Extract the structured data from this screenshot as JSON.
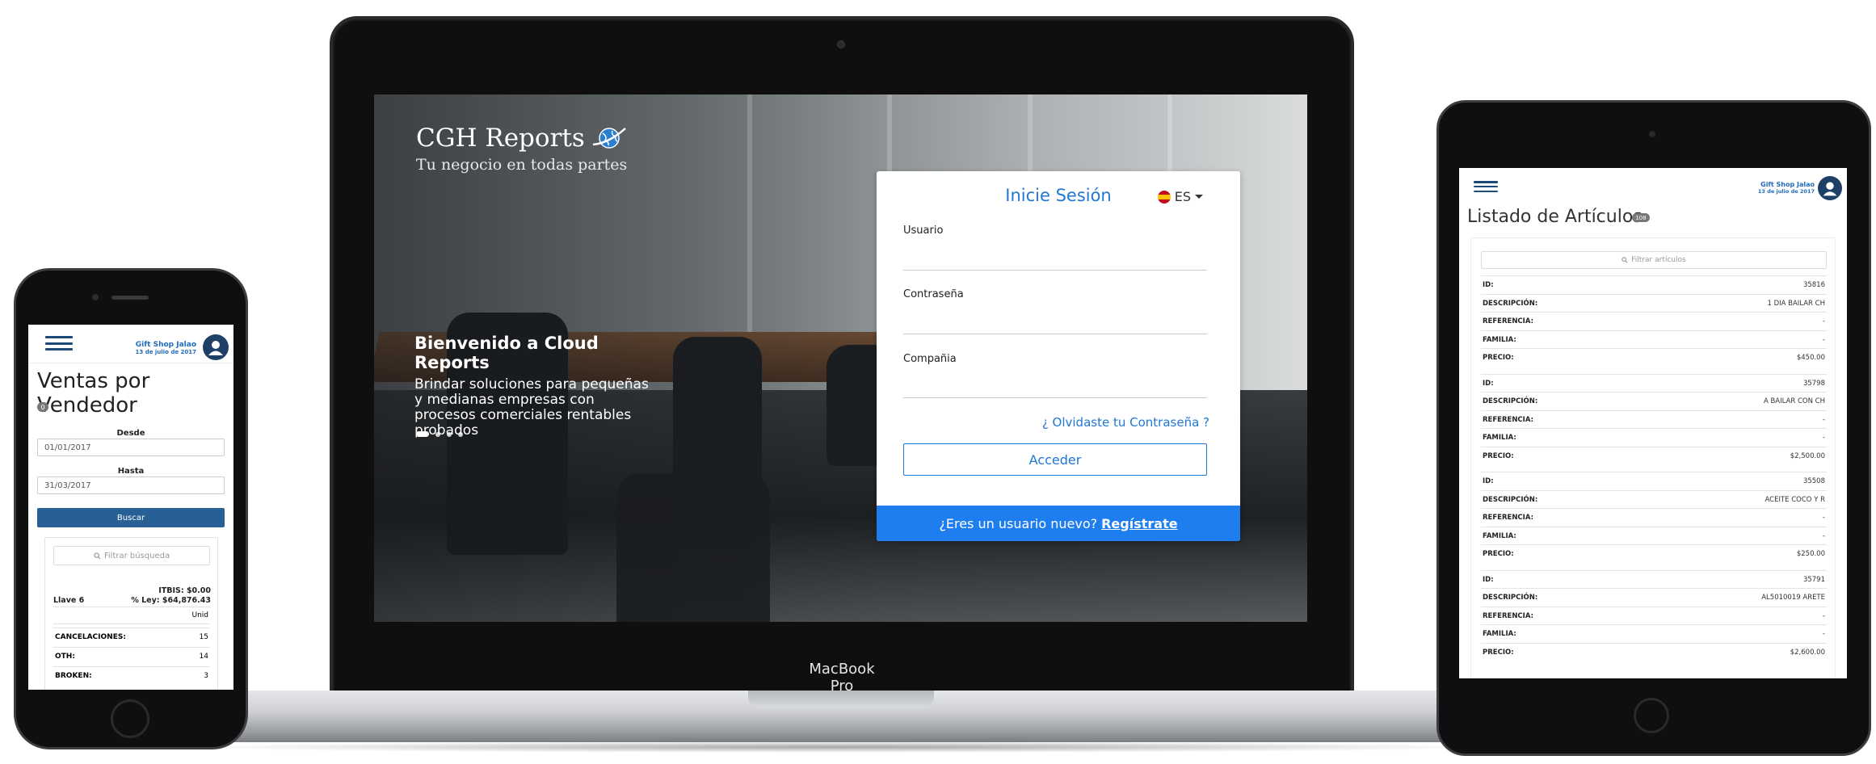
{
  "laptop": {
    "app_name": "CGH Reports",
    "tagline": "Tu negocio en todas partes",
    "welcome_title": "Bienvenido a Cloud Reports",
    "welcome_text": "Brindar soluciones para pequeñas y medianas empresas con procesos comerciales rentables probados",
    "carousel_slides": 4,
    "carousel_active": 1,
    "login": {
      "title": "Inicie Sesión",
      "language": "ES",
      "user_label": "Usuario",
      "user_value": "",
      "password_label": "Contraseña",
      "password_value": "",
      "company_label": "Compañia",
      "company_value": "",
      "forgot_link": "¿ Olvidaste tu Contraseña ?",
      "submit_label": "Acceder",
      "register_prompt": "¿Eres un usuario nuevo?",
      "register_link": "Regístrate"
    },
    "device_label": "MacBook Pro",
    "accent_color": "#2077d6",
    "register_bar_color": "#1e7ef0"
  },
  "phone": {
    "brand": "Gift Shop Jalao",
    "date": "13 de julio de 2017",
    "title": "Ventas por Vendedor",
    "badge": "0",
    "from_label": "Desde",
    "from_value": "01/01/2017",
    "to_label": "Hasta",
    "to_value": "31/03/2017",
    "search_button": "Buscar",
    "filter_placeholder": "Filtrar búsqueda",
    "itbis": "ITBIS: $0.00",
    "ley": "% Ley: $64,876.43",
    "seller": "Llave 6",
    "unit_header": "Unid",
    "rows": [
      {
        "label": "CANCELACIONES:",
        "value": "15"
      },
      {
        "label": "OTH:",
        "value": "14"
      },
      {
        "label": "BROKEN:",
        "value": "3"
      }
    ],
    "button_color": "#285f94"
  },
  "tablet": {
    "brand": "Gift Shop Jalao",
    "date": "13 de julio de 2017",
    "title": "Listado de Artículos",
    "badge": "108",
    "filter_placeholder": "Filtrar artículos",
    "field_labels": {
      "id": "ID:",
      "description": "DESCRIPCIÓN:",
      "reference": "REFERENCIA:",
      "family": "FAMILIA:",
      "price": "PRECIO:"
    },
    "articles": [
      {
        "id": "35816",
        "description": "1 DIA BAILAR CH",
        "reference": "-",
        "family": "-",
        "price": "$450.00"
      },
      {
        "id": "35798",
        "description": "A BAILAR CON CH",
        "reference": "-",
        "family": "-",
        "price": "$2,500.00"
      },
      {
        "id": "35508",
        "description": "ACEITE COCO Y R",
        "reference": "-",
        "family": "-",
        "price": "$250.00"
      },
      {
        "id": "35791",
        "description": "AL5010019 ARETE",
        "reference": "-",
        "family": "-",
        "price": "$2,600.00"
      }
    ]
  }
}
